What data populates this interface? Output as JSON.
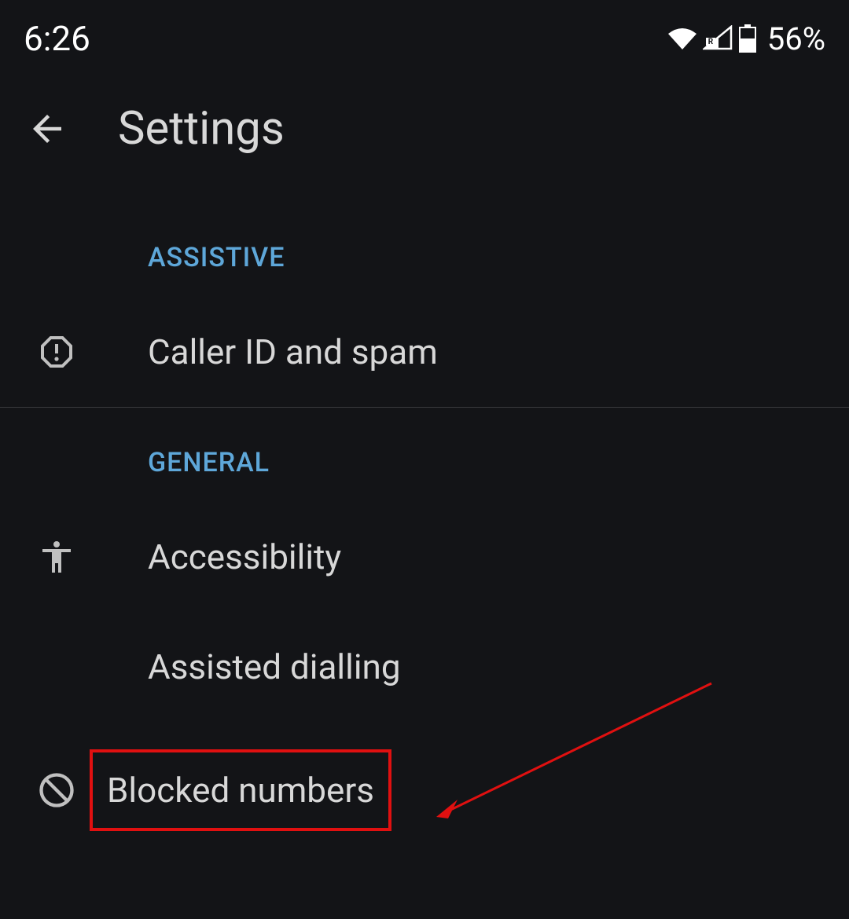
{
  "status_bar": {
    "time": "6:26",
    "battery": "56%"
  },
  "header": {
    "title": "Settings"
  },
  "sections": {
    "assistive": {
      "label": "ASSISTIVE",
      "items": [
        {
          "label": "Caller ID and spam"
        }
      ]
    },
    "general": {
      "label": "GENERAL",
      "items": [
        {
          "label": "Accessibility"
        },
        {
          "label": "Assisted dialling"
        },
        {
          "label": "Blocked numbers"
        }
      ]
    }
  }
}
